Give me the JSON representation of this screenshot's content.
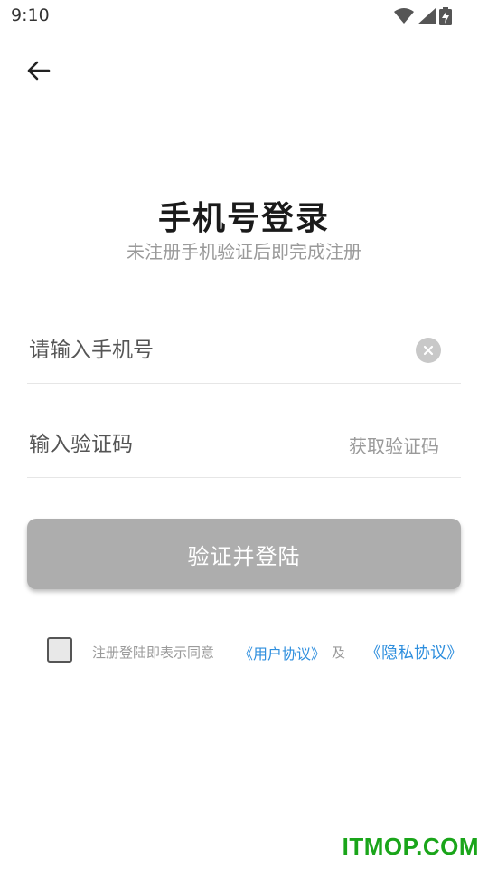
{
  "status_bar": {
    "time": "9:10",
    "icons": [
      "wifi-icon",
      "cell-signal-icon",
      "battery-charging-icon"
    ]
  },
  "nav": {
    "back_icon": "arrow-left-icon"
  },
  "header": {
    "title": "手机号登录",
    "subtitle": "未注册手机验证后即完成注册"
  },
  "form": {
    "phone_placeholder": "请输入手机号",
    "phone_value": "",
    "code_placeholder": "输入验证码",
    "code_value": "",
    "get_code_label": "获取验证码",
    "clear_icon": "clear-icon"
  },
  "submit": {
    "label": "验证并登陆"
  },
  "agreement": {
    "checked": false,
    "text": "注册登陆即表示同意",
    "user_agreement": "《用户协议》",
    "and": "及",
    "privacy_agreement": "《隐私协议》"
  },
  "watermark": "ITMOP.COM",
  "colors": {
    "accent_link": "#2f8fde",
    "button_disabled": "#adadad",
    "watermark": "#1aa51a"
  }
}
